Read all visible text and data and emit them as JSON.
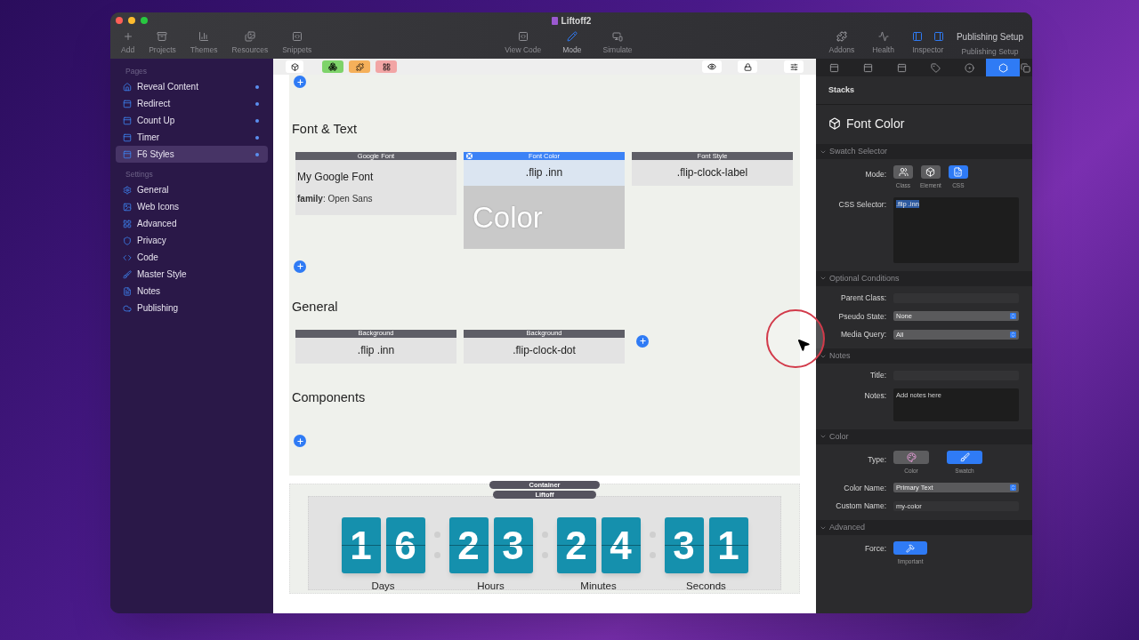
{
  "window": {
    "title": "Liftoff2"
  },
  "toolbar": {
    "left": [
      {
        "label": "Add",
        "selected": false
      },
      {
        "label": "Projects",
        "selected": false
      },
      {
        "label": "Themes",
        "selected": false
      },
      {
        "label": "Resources",
        "selected": false
      },
      {
        "label": "Snippets",
        "selected": false
      }
    ],
    "center": [
      {
        "label": "View Code",
        "selected": false
      },
      {
        "label": "Mode",
        "selected": true
      },
      {
        "label": "Simulate",
        "selected": false
      }
    ],
    "right": [
      {
        "label": "Addons",
        "selected": false
      },
      {
        "label": "Health",
        "selected": false
      },
      {
        "label": "Inspector",
        "selected": true
      }
    ],
    "publishing": {
      "button": "Publishing Setup",
      "label": "Publishing Setup"
    }
  },
  "sidebar": {
    "sections": [
      {
        "title": "Pages",
        "items": [
          {
            "label": "Reveal Content",
            "selected": false
          },
          {
            "label": "Redirect",
            "selected": false
          },
          {
            "label": "Count Up",
            "selected": false
          },
          {
            "label": "Timer",
            "selected": false
          },
          {
            "label": "F6 Styles",
            "selected": true
          }
        ]
      },
      {
        "title": "Settings",
        "items": [
          {
            "label": "General",
            "selected": false
          },
          {
            "label": "Web Icons",
            "selected": false
          },
          {
            "label": "Advanced",
            "selected": false
          },
          {
            "label": "Privacy",
            "selected": false
          },
          {
            "label": "Code",
            "selected": false
          },
          {
            "label": "Master Style",
            "selected": false
          },
          {
            "label": "Notes",
            "selected": false
          },
          {
            "label": "Publishing",
            "selected": false
          }
        ]
      }
    ]
  },
  "canvas": {
    "sections": [
      {
        "heading": "Font & Text",
        "cards": [
          {
            "header": "Google Font",
            "selected": false,
            "lines": [
              "My Google Font",
              "**family**: Open Sans"
            ]
          },
          {
            "header": "Font Color",
            "selected": true,
            "lines": [
              ".flip .inn"
            ],
            "preview": "Color"
          },
          {
            "header": "Font Style",
            "selected": false,
            "lines": [
              ".flip-clock-label"
            ]
          }
        ]
      },
      {
        "heading": "General",
        "cards": [
          {
            "header": "Background",
            "selected": false,
            "lines": [
              ".flip .inn"
            ]
          },
          {
            "header": "Background",
            "selected": false,
            "lines": [
              ".flip-clock-dot"
            ]
          }
        ]
      },
      {
        "heading": "Components"
      }
    ],
    "timer": {
      "badges": [
        "Container",
        "Liftoff"
      ],
      "units": [
        {
          "digits": [
            "1",
            "6"
          ],
          "label": "Days"
        },
        {
          "digits": [
            "2",
            "3"
          ],
          "label": "Hours"
        },
        {
          "digits": [
            "2",
            "4"
          ],
          "label": "Minutes"
        },
        {
          "digits": [
            "3",
            "1"
          ],
          "label": "Seconds"
        }
      ]
    }
  },
  "inspector": {
    "tabs": [
      {
        "selected": false
      },
      {
        "selected": false
      },
      {
        "selected": false
      },
      {
        "selected": false
      },
      {
        "selected": false
      },
      {
        "selected": true
      },
      {
        "selected": false
      }
    ],
    "header": "Stacks",
    "title": "Font Color",
    "sections": [
      {
        "title": "Swatch Selector",
        "expanded": true,
        "rows": [
          {
            "kind": "options",
            "label": "Mode:",
            "options": [
              {
                "label": "Class",
                "selected": false
              },
              {
                "label": "Element",
                "selected": false
              },
              {
                "label": "CSS",
                "selected": true
              }
            ]
          },
          {
            "kind": "textarea",
            "label": "CSS Selector:",
            "value": ".flip .inn"
          }
        ]
      },
      {
        "title": "Optional Conditions",
        "expanded": true,
        "rows": [
          {
            "kind": "field",
            "label": "Parent Class:"
          },
          {
            "kind": "select",
            "label": "Pseudo State:",
            "value": "None"
          },
          {
            "kind": "select",
            "label": "Media Query:",
            "value": "All"
          }
        ]
      },
      {
        "title": "Notes",
        "expanded": true,
        "rows": [
          {
            "kind": "field",
            "label": "Title:"
          },
          {
            "kind": "textarea",
            "label": "Notes:",
            "placeholder": "Add notes here"
          }
        ]
      },
      {
        "title": "Color",
        "expanded": true,
        "rows": [
          {
            "kind": "options",
            "label": "Type:",
            "options": [
              {
                "label": "Color",
                "selected": false
              },
              {
                "label": "Swatch",
                "selected": true
              }
            ]
          },
          {
            "kind": "select",
            "label": "Color Name:",
            "value": "Primary Text"
          },
          {
            "kind": "field",
            "label": "Custom Name:",
            "value": "my-color"
          }
        ]
      },
      {
        "title": "Advanced",
        "expanded": true,
        "rows": [
          {
            "kind": "toggle",
            "label": "Force:",
            "caption": "!important",
            "on": true
          }
        ]
      }
    ]
  }
}
